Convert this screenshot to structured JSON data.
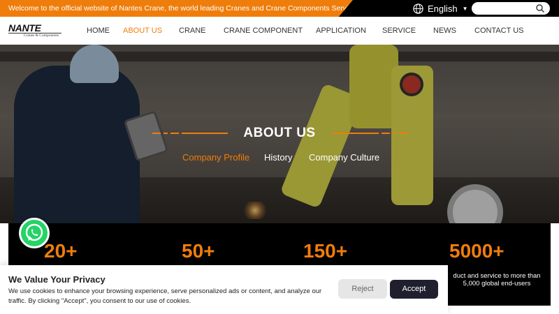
{
  "topbar": {
    "welcome": "Welcome to the official website of Nantes Crane, the world leading Cranes and Crane Components Service Provider.",
    "language": "English",
    "language_icon": "globe-icon",
    "search_placeholder": "",
    "search_icon": "search-icon"
  },
  "logo": {
    "main": "NANTE",
    "sub": "Cranes & Components"
  },
  "nav": {
    "items": [
      {
        "label": "HOME"
      },
      {
        "label": "ABOUT US"
      },
      {
        "label": "CRANE"
      },
      {
        "label": "CRANE COMPONENT"
      },
      {
        "label": "APPLICATION"
      },
      {
        "label": "SERVICE"
      },
      {
        "label": "NEWS"
      },
      {
        "label": "CONTACT US"
      }
    ],
    "active": "ABOUT US"
  },
  "hero": {
    "title": "ABOUT US",
    "subnav": [
      {
        "label": "Company Profile"
      },
      {
        "label": "History"
      },
      {
        "label": "Company Culture"
      }
    ],
    "active_subnav": "Company Profile"
  },
  "stats": [
    {
      "value": "20+",
      "description": ""
    },
    {
      "value": "50+",
      "description": ""
    },
    {
      "value": "150+",
      "description": ""
    },
    {
      "value": "5000+",
      "description": "duct and service to more than 5,000 global end-users"
    }
  ],
  "whatsapp": {
    "icon": "whatsapp-icon"
  },
  "cookie": {
    "title": "We Value Your Privacy",
    "text": "We use cookies to enhance your browsing experience, serve personalized ads or content, and analyze our traffic. By clicking \"Accept\", you consent to our use of cookies.",
    "reject": "Reject",
    "accept": "Accept"
  },
  "colors": {
    "accent": "#ef7d0b",
    "dark": "#000000",
    "accept_bg": "#1f1f2e",
    "whatsapp": "#25d366"
  }
}
